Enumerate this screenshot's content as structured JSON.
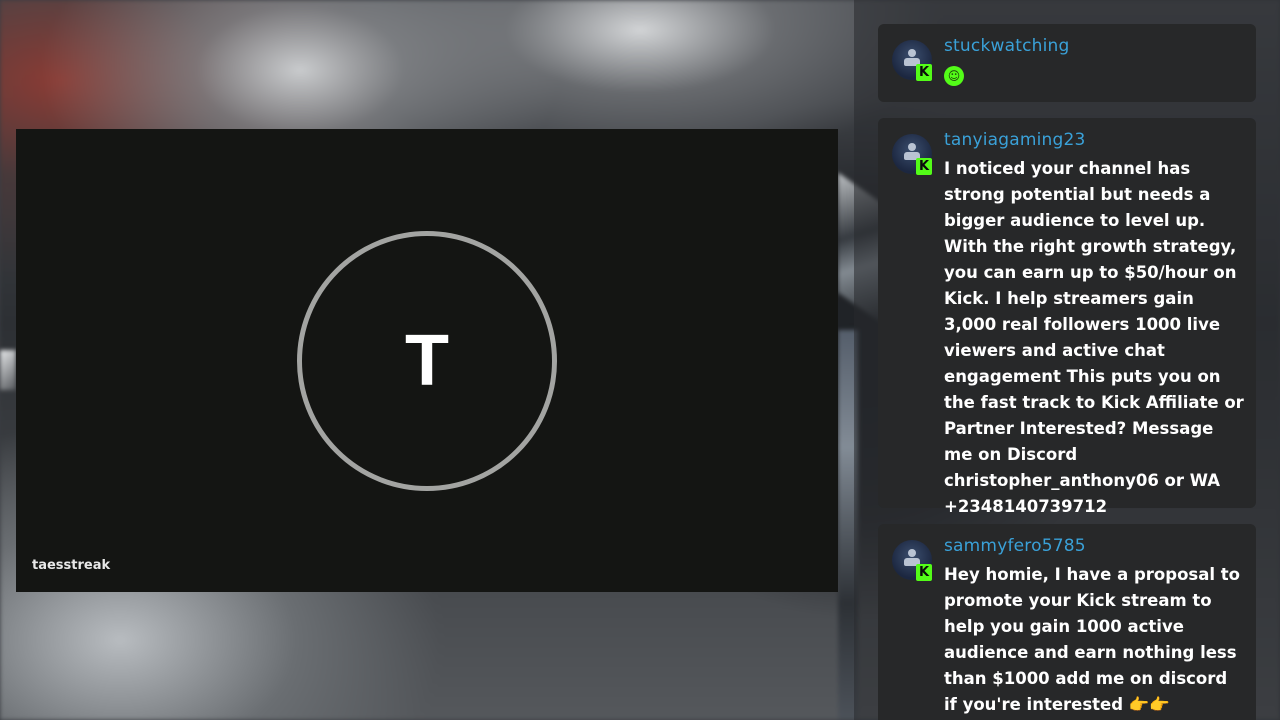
{
  "player": {
    "avatar_letter": "T",
    "channel_name": "taesstreak"
  },
  "chat": {
    "messages": [
      {
        "username": "stuckwatching",
        "text": "",
        "emote": "kick-emote-icon",
        "badge": "K"
      },
      {
        "username": "tanyiagaming23",
        "text": "I noticed your channel has strong potential but needs a bigger audience to level up. With the right growth strategy, you can earn up to $50/hour on Kick. I help streamers gain 3,000 real followers 1000 live viewers and active chat engagement This puts you on the fast track to Kick Affiliate or Partner Interested? Message me on Discord christopher_anthony06 or WA +2348140739712",
        "badge": "K"
      },
      {
        "username": "sammyfero5785",
        "text": "Hey homie, I have a proposal to promote your Kick stream to help you gain 1000 active audience and earn nothing less than $1000 add me on discord if you're interested 👉👉 mrbuzzup",
        "badge": "K"
      }
    ]
  },
  "colors": {
    "username": "#3aa1d8",
    "kick_green": "#53fc18",
    "message_bg": "#272829",
    "player_bg": "#141513"
  }
}
